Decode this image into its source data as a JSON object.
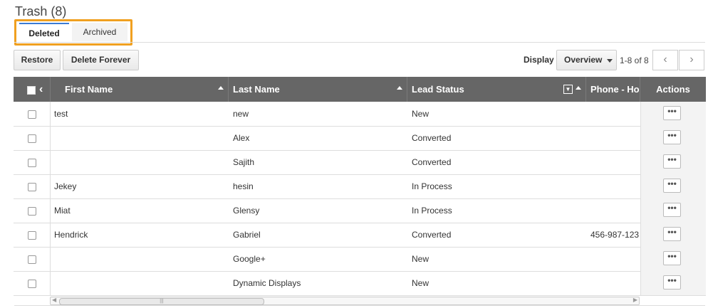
{
  "page": {
    "title": "Trash (8)"
  },
  "tabs": [
    {
      "label": "Deleted",
      "active": true
    },
    {
      "label": "Archived",
      "active": false
    }
  ],
  "toolbar": {
    "restore_label": "Restore",
    "delete_forever_label": "Delete Forever",
    "display_label": "Display",
    "display_value": "Overview",
    "pager_text": "1-8 of 8"
  },
  "table": {
    "columns": [
      "First Name",
      "Last Name",
      "Lead Status",
      "Phone - Ho",
      "Actions"
    ],
    "rows": [
      {
        "first": "test",
        "last": "new",
        "status": "New",
        "phone": ""
      },
      {
        "first": "",
        "last": "Alex",
        "status": "Converted",
        "phone": ""
      },
      {
        "first": "",
        "last": "Sajith",
        "status": "Converted",
        "phone": ""
      },
      {
        "first": "Jekey",
        "last": "hesin",
        "status": "In Process",
        "phone": ""
      },
      {
        "first": "Miat",
        "last": "Glensy",
        "status": "In Process",
        "phone": ""
      },
      {
        "first": "Hendrick",
        "last": "Gabriel",
        "status": "Converted",
        "phone": "456-987-123"
      },
      {
        "first": "",
        "last": "Google+",
        "status": "New",
        "phone": ""
      },
      {
        "first": "",
        "last": "Dynamic Displays",
        "status": "New",
        "phone": ""
      }
    ],
    "actions_glyph": "•••"
  },
  "colors": {
    "header_bg": "#666666",
    "tab_highlight": "#f0a020",
    "active_tab_accent": "#3a7bd5"
  }
}
